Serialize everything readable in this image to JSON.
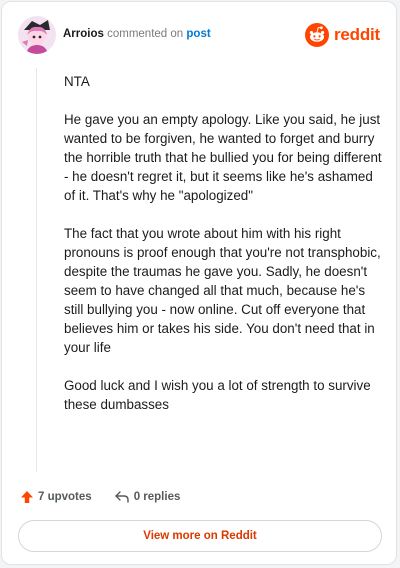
{
  "header": {
    "author": "Arroios",
    "action": "commented on",
    "target": "post",
    "brand": "reddit"
  },
  "comment": {
    "paragraphs": [
      "NTA",
      "He gave you an empty apology. Like you said, he just wanted to be forgiven, he wanted to forget and burry the horrible truth that he bullied you for being different - he doesn't regret it, but it seems like he's ashamed of it. That's why he \"apologized\"",
      "The fact that you wrote about him with his right pronouns is proof enough that you're not transphobic, despite the traumas he gave you. Sadly, he doesn't seem to have changed all that much, because he's still bullying you - now online. Cut off everyone that believes him or takes his side. You don't need that in your life",
      "Good luck and I wish you a lot of strength to survive these dumbasses"
    ]
  },
  "actions": {
    "upvotes": "7 upvotes",
    "replies": "0 replies"
  },
  "footer": {
    "view_more": "View more on Reddit"
  },
  "colors": {
    "brand": "#ff4500",
    "link": "#0079d3",
    "view_more_text": "#d93a00"
  },
  "icons": [
    "avatar",
    "reddit-logo-icon",
    "upvote-arrow-icon",
    "reply-arrow-icon"
  ]
}
